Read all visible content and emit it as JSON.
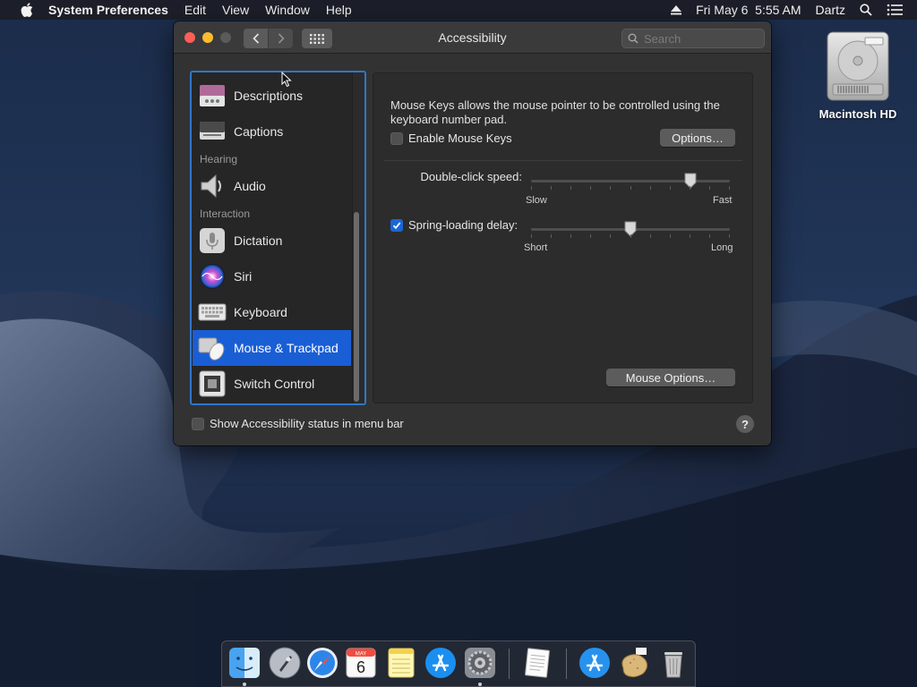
{
  "menubar": {
    "app_name": "System Preferences",
    "menus": [
      "Edit",
      "View",
      "Window",
      "Help"
    ],
    "datetime": "Fri May 6  5:55 AM",
    "user": "Dartz"
  },
  "desktop": {
    "disk_label": "Macintosh HD"
  },
  "window": {
    "title": "Accessibility",
    "search_placeholder": "Search"
  },
  "sidebar": {
    "items": [
      {
        "label": "Descriptions",
        "icon": "descriptions-icon"
      },
      {
        "label": "Captions",
        "icon": "captions-icon"
      },
      {
        "label": "Audio",
        "icon": "speaker-icon"
      },
      {
        "label": "Dictation",
        "icon": "microphone-icon"
      },
      {
        "label": "Siri",
        "icon": "siri-icon"
      },
      {
        "label": "Keyboard",
        "icon": "keyboard-icon"
      },
      {
        "label": "Mouse & Trackpad",
        "icon": "mouse-trackpad-icon",
        "selected": true
      },
      {
        "label": "Switch Control",
        "icon": "switch-control-icon"
      }
    ],
    "sections": {
      "hearing": "Hearing",
      "interaction": "Interaction"
    }
  },
  "panel": {
    "description": "Mouse Keys allows the mouse pointer to be controlled using the keyboard number pad.",
    "enable_mouse_keys_label": "Enable Mouse Keys",
    "enable_mouse_keys_checked": false,
    "options_button": "Options…",
    "double_click": {
      "label": "Double-click speed:",
      "min_label": "Slow",
      "max_label": "Fast",
      "value": 0.8
    },
    "spring_loading": {
      "label": "Spring-loading delay:",
      "checked": true,
      "min_label": "Short",
      "max_label": "Long",
      "value": 0.5
    },
    "mouse_options_button": "Mouse Options…"
  },
  "footer": {
    "status_label": "Show Accessibility status in menu bar",
    "status_checked": false,
    "help": "?"
  },
  "dock": {
    "apps": [
      "finder-icon",
      "launchpad-icon",
      "safari-icon",
      "calendar-icon",
      "notes-icon",
      "app-store-icon",
      "system-preferences-icon",
      "textedit-icon",
      "app-store-downloads-icon",
      "potato-icon",
      "trash-icon"
    ],
    "calendar_month": "MAY",
    "calendar_day": "6"
  },
  "colors": {
    "accent": "#1a5ed6",
    "focus_ring": "#2f77c8",
    "window_bg": "#323232"
  }
}
